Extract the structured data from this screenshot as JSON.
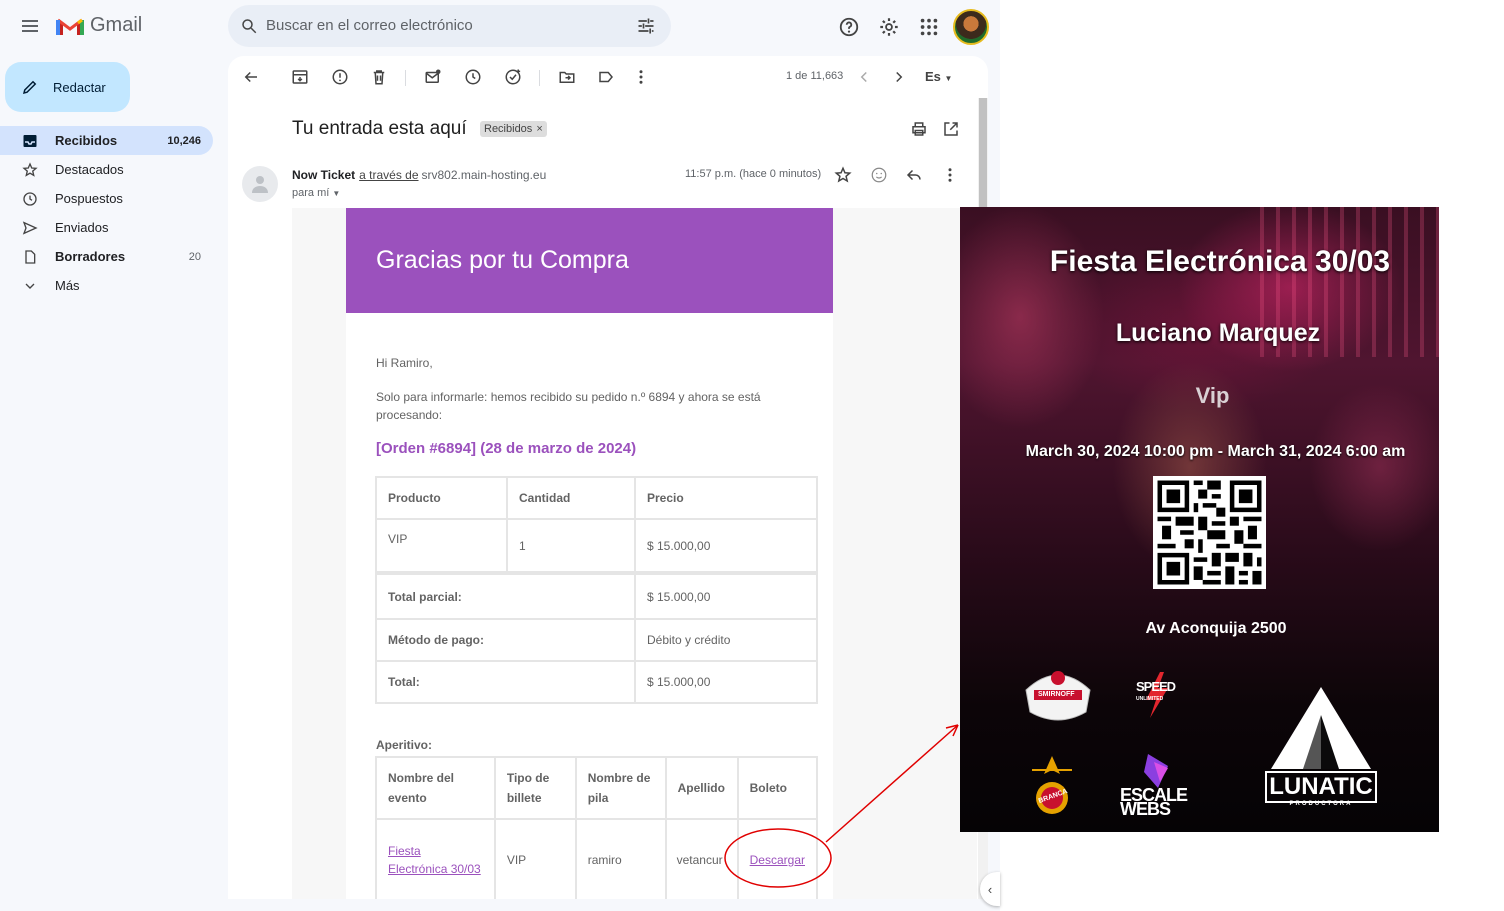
{
  "app": {
    "name": "Gmail",
    "search_placeholder": "Buscar en el correo electrónico"
  },
  "compose_label": "Redactar",
  "nav": [
    {
      "label": "Recibidos",
      "count": "10,246",
      "icon": "inbox-icon"
    },
    {
      "label": "Destacados",
      "count": "",
      "icon": "star-icon"
    },
    {
      "label": "Pospuestos",
      "count": "",
      "icon": "clock-icon"
    },
    {
      "label": "Enviados",
      "count": "",
      "icon": "send-icon"
    },
    {
      "label": "Borradores",
      "count": "20",
      "icon": "draft-icon"
    },
    {
      "label": "Más",
      "count": "",
      "icon": "chevron-down-icon"
    }
  ],
  "toolbar": {
    "pager": "1 de 11,663",
    "language": "Es"
  },
  "message": {
    "subject": "Tu entrada esta aquí",
    "label": "Recibidos",
    "sender_name": "Now Ticket",
    "via": "a través de",
    "host": "srv802.main-hosting.eu",
    "recipient": "para mí",
    "time": "11:57 p.m. (hace 0 minutos)"
  },
  "email": {
    "banner": "Gracias por tu Compra",
    "greeting": "Hi Ramiro,",
    "intro": "Solo para informarle: hemos recibido su pedido n.º 6894 y ahora se está procesando:",
    "order_title": "[Orden #6894] (28 de marzo de 2024)",
    "order_table": {
      "headers": [
        "Producto",
        "Cantidad",
        "Precio"
      ],
      "item": {
        "product": "VIP",
        "qty": "1",
        "price": "$ 15.000,00"
      },
      "totals": [
        {
          "label": "Total parcial:",
          "value": "$ 15.000,00"
        },
        {
          "label": "Método de pago:",
          "value": "Débito y crédito"
        },
        {
          "label": "Total:",
          "value": "$ 15.000,00"
        }
      ]
    },
    "aperitivo_label": "Aperitivo:",
    "tickets_table": {
      "headers": [
        "Nombre del evento",
        "Tipo de billete",
        "Nombre de pila",
        "Apellido",
        "Boleto"
      ],
      "row": {
        "event": "Fiesta Electrónica 30/03",
        "type": "VIP",
        "first": "ramiro",
        "last": "vetancur",
        "download": "Descargar"
      }
    }
  },
  "ticket": {
    "title": "Fiesta Electrónica 30/03",
    "artist": "Luciano Marquez",
    "type": "Vip",
    "date": "March 30, 2024 10:00 pm - March 31, 2024 6:00 am",
    "venue": "Av Aconquija 2500",
    "sponsors": {
      "smirnoff": "SMIRNOFF",
      "speed_a": "SPEED",
      "speed_b": "UNLIMITED",
      "branca": "BRANCA",
      "escale_a": "ESCALE",
      "escale_b": "WEBS",
      "lunatic_a": "LUNATIC",
      "lunatic_b": "PRODUCTORA"
    }
  },
  "colors": {
    "accent": "#9b51bd",
    "compose": "#c2e7ff",
    "nav_active": "#d3e3fd",
    "annotation": "#e00000"
  }
}
